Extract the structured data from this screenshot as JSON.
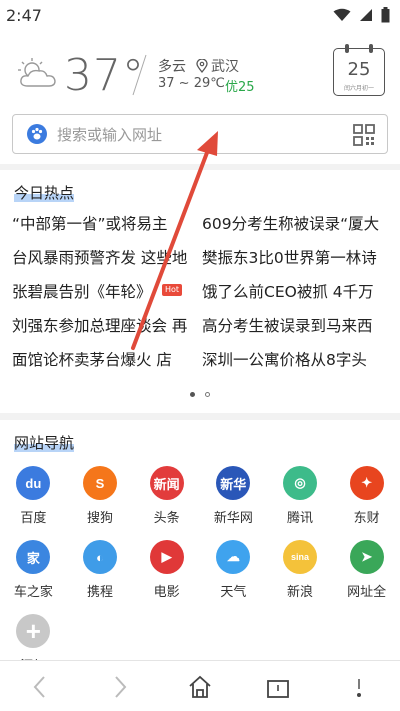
{
  "status": {
    "time": "2:47"
  },
  "weather": {
    "temp": "37°",
    "condition": "多云",
    "city": "武汉",
    "range": "37 ~ 29℃",
    "aqi": "优25",
    "calendar_day": "25",
    "calendar_lunar": "闰六月初一"
  },
  "search": {
    "placeholder": "搜索或输入网址"
  },
  "hot": {
    "title": "今日热点",
    "badge": "Hot",
    "items": [
      "“中部第一省”或将易主",
      "609分考生称被误录“厦大",
      "台风暴雨预警齐发 这些地",
      "樊振东3比0世界第一林诗",
      "张碧晨告别《年轮》",
      "饿了么前CEO被抓 4千万",
      "刘强东参加总理座谈会 再",
      "高分考生被误录到马来西",
      "面馆论杯卖茅台爆火 店",
      "深圳一公寓价格从8字头"
    ]
  },
  "sites": {
    "title": "网站导航",
    "items": [
      {
        "label": "百度",
        "icon": "baidu-icon",
        "glyph": "du",
        "color": "#3b7bdf"
      },
      {
        "label": "搜狗",
        "icon": "sogou-icon",
        "glyph": "S",
        "color": "#f5761a"
      },
      {
        "label": "头条",
        "icon": "toutiao-icon",
        "glyph": "新闻",
        "color": "#e23c3c"
      },
      {
        "label": "新华网",
        "icon": "xinhua-icon",
        "glyph": "新华",
        "color": "#2a57b8"
      },
      {
        "label": "腾讯",
        "icon": "tencent-icon",
        "glyph": "◎",
        "color": "#3dbb8a"
      },
      {
        "label": "东财",
        "icon": "eastmoney-icon",
        "glyph": "✦",
        "color": "#e8451f"
      },
      {
        "label": "车之家",
        "icon": "autohome-icon",
        "glyph": "家",
        "color": "#3b86e0"
      },
      {
        "label": "携程",
        "icon": "ctrip-icon",
        "glyph": "◐",
        "color": "#3f9ce8"
      },
      {
        "label": "电影",
        "icon": "movie-icon",
        "glyph": "▶",
        "color": "#e03838"
      },
      {
        "label": "天气",
        "icon": "weather-icon",
        "glyph": "☁",
        "color": "#3fa3ee"
      },
      {
        "label": "新浪",
        "icon": "sina-icon",
        "glyph": "sina",
        "color": "#f4c23a"
      },
      {
        "label": "网址全",
        "icon": "compass-icon",
        "glyph": "➤",
        "color": "#3aa759"
      },
      {
        "label": "添加",
        "icon": "add-icon",
        "glyph": "+",
        "color": "#c8c8c8"
      }
    ]
  },
  "colors": {
    "arrow": "#e04a3a",
    "aqi": "#2aa84a"
  }
}
